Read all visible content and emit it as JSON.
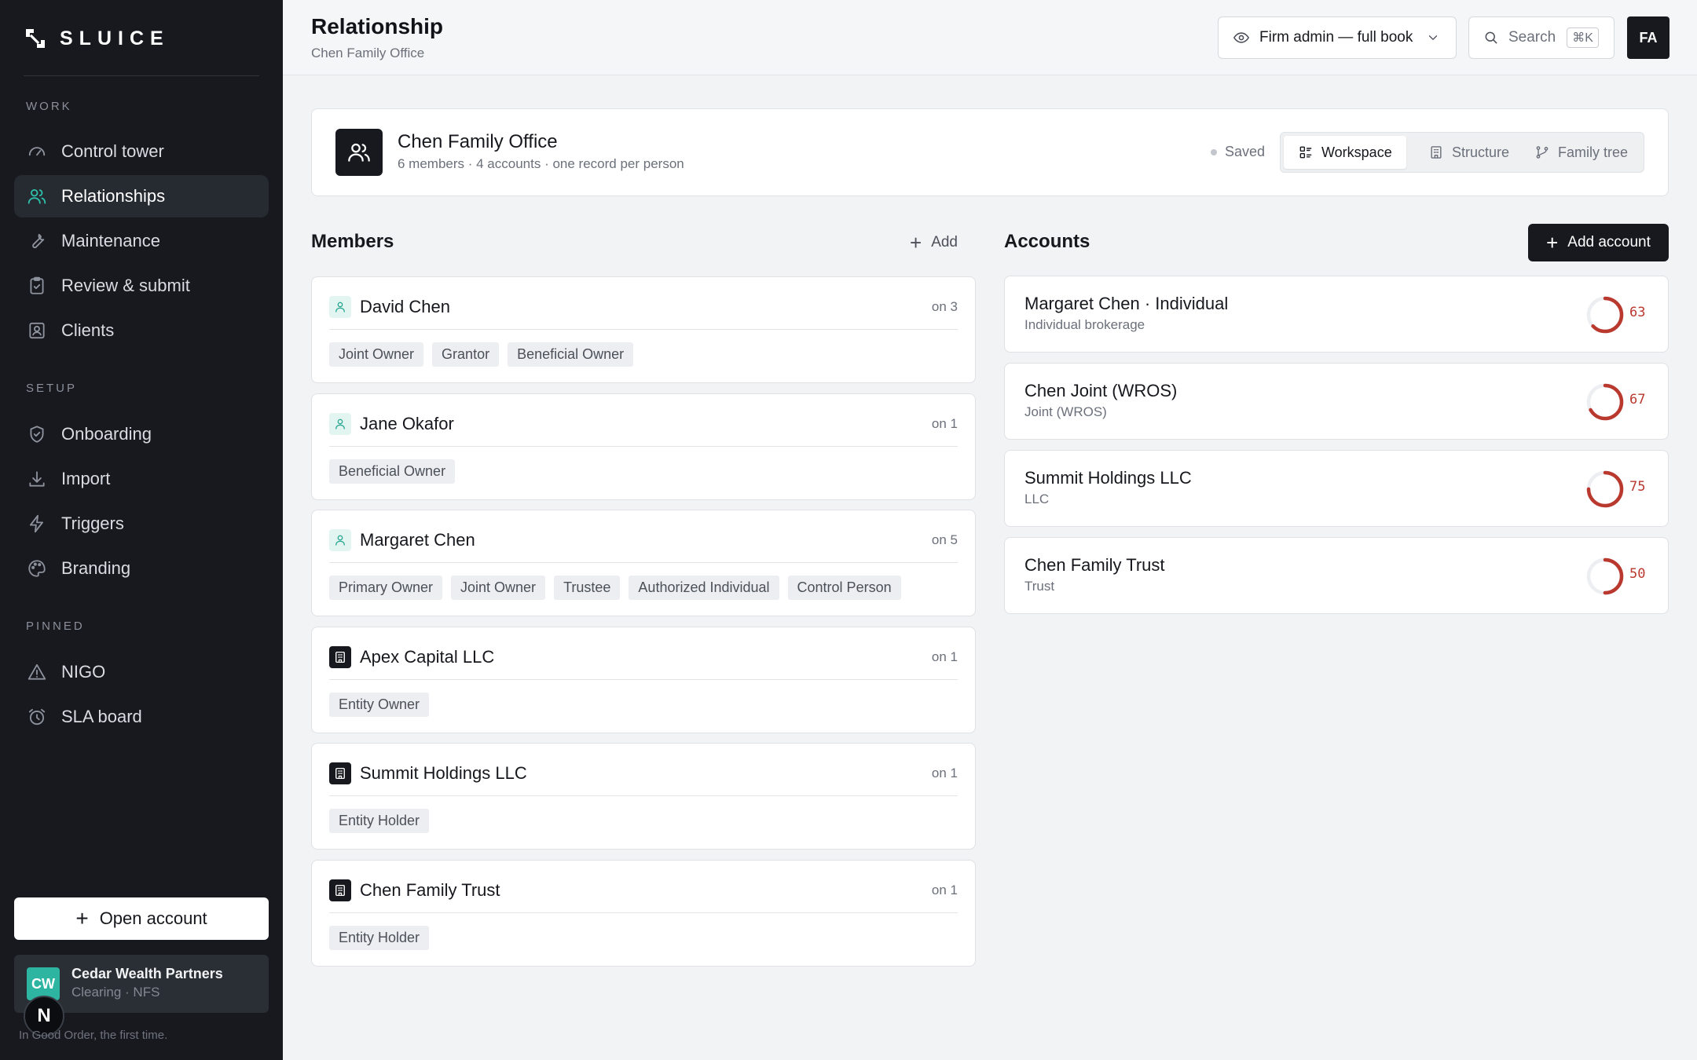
{
  "brand": {
    "name": "SLUICE",
    "tagline": "In Good Order, the first time."
  },
  "sidebar": {
    "sections": [
      {
        "label": "WORK",
        "items": [
          {
            "label": "Control tower",
            "icon": "gauge-icon"
          },
          {
            "label": "Relationships",
            "icon": "users-icon",
            "active": true
          },
          {
            "label": "Maintenance",
            "icon": "wrench-icon"
          },
          {
            "label": "Review & submit",
            "icon": "clipboard-check-icon"
          },
          {
            "label": "Clients",
            "icon": "contact-icon"
          }
        ]
      },
      {
        "label": "SETUP",
        "items": [
          {
            "label": "Onboarding",
            "icon": "shield-check-icon"
          },
          {
            "label": "Import",
            "icon": "download-icon"
          },
          {
            "label": "Triggers",
            "icon": "bolt-icon"
          },
          {
            "label": "Branding",
            "icon": "palette-icon"
          }
        ]
      },
      {
        "label": "PINNED",
        "items": [
          {
            "label": "NIGO",
            "icon": "warning-icon"
          },
          {
            "label": "SLA board",
            "icon": "alarm-icon"
          }
        ]
      }
    ],
    "open_account": "Open account",
    "org": {
      "initials": "CW",
      "name": "Cedar Wealth Partners",
      "sub": "Clearing · NFS"
    },
    "n_badge": "N"
  },
  "header": {
    "title": "Relationship",
    "subtitle": "Chen Family Office",
    "role_select": "Firm admin — full book",
    "search": "Search",
    "search_kbd": "⌘K",
    "user_initials": "FA"
  },
  "household": {
    "name": "Chen Family Office",
    "meta": "6 members · 4 accounts · one record per person",
    "status": "Saved",
    "views": [
      "Workspace",
      "Structure",
      "Family tree"
    ],
    "active_view": "Workspace"
  },
  "members": {
    "title": "Members",
    "add_label": "Add",
    "items": [
      {
        "name": "David Chen",
        "kind": "person",
        "count": "on 3",
        "roles": [
          "Joint Owner",
          "Grantor",
          "Beneficial Owner"
        ]
      },
      {
        "name": "Jane Okafor",
        "kind": "person",
        "count": "on 1",
        "roles": [
          "Beneficial Owner"
        ]
      },
      {
        "name": "Margaret Chen",
        "kind": "person",
        "count": "on 5",
        "roles": [
          "Primary Owner",
          "Joint Owner",
          "Trustee",
          "Authorized Individual",
          "Control Person"
        ]
      },
      {
        "name": "Apex Capital LLC",
        "kind": "entity",
        "count": "on 1",
        "roles": [
          "Entity Owner"
        ]
      },
      {
        "name": "Summit Holdings LLC",
        "kind": "entity",
        "count": "on 1",
        "roles": [
          "Entity Holder"
        ]
      },
      {
        "name": "Chen Family Trust",
        "kind": "entity",
        "count": "on 1",
        "roles": [
          "Entity Holder"
        ]
      }
    ]
  },
  "accounts": {
    "title": "Accounts",
    "add_label": "Add account",
    "items": [
      {
        "name": "Margaret Chen · Individual",
        "type": "Individual brokerage",
        "score": "63",
        "score_value": 63
      },
      {
        "name": "Chen Joint (WROS)",
        "type": "Joint (WROS)",
        "score": "67",
        "score_value": 67
      },
      {
        "name": "Summit Holdings LLC",
        "type": "LLC",
        "score": "75",
        "score_value": 75
      },
      {
        "name": "Chen Family Trust",
        "type": "Trust",
        "score": "50",
        "score_value": 50
      }
    ]
  },
  "colors": {
    "accent": "#2fc1aa",
    "dark": "#17191f",
    "danger": "#b9392f"
  }
}
